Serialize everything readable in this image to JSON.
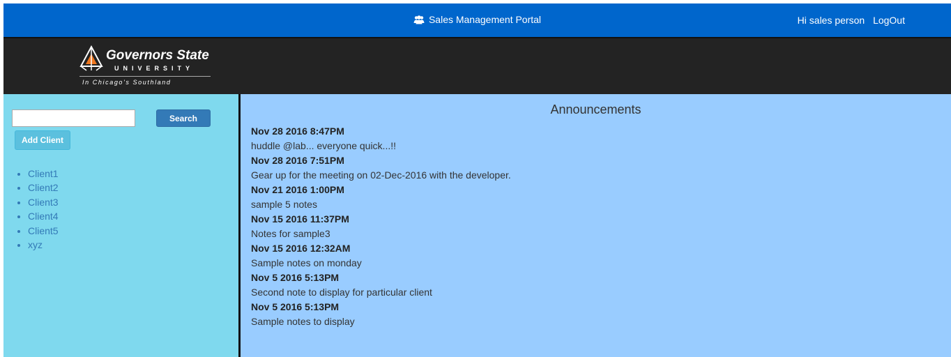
{
  "header": {
    "title": "Sales Management Portal",
    "title_icon": "users-icon",
    "greeting": "Hi sales person",
    "logout_label": "LogOut",
    "bar_color": "#0066cc"
  },
  "logo": {
    "name": "Governors State",
    "university": "UNIVERSITY",
    "tagline": "In Chicago's Southland"
  },
  "sidebar": {
    "search_placeholder": "",
    "search_value": "",
    "search_label": "Search",
    "add_client_label": "Add Client",
    "clients": [
      "Client1",
      "Client2",
      "Client3",
      "Client4",
      "Client5",
      "xyz"
    ],
    "bg_color": "#7fd9ee"
  },
  "main": {
    "title": "Announcements",
    "bg_color": "#99ccff",
    "announcements": [
      {
        "date": "Nov 28 2016 8:47PM",
        "text": "huddle @lab... everyone quick...!!"
      },
      {
        "date": "Nov 28 2016 7:51PM",
        "text": "Gear up for the meeting on 02-Dec-2016 with the developer."
      },
      {
        "date": "Nov 21 2016 1:00PM",
        "text": "sample 5 notes"
      },
      {
        "date": "Nov 15 2016 11:37PM",
        "text": "Notes for sample3"
      },
      {
        "date": "Nov 15 2016 12:32AM",
        "text": "Sample notes on monday"
      },
      {
        "date": "Nov 5 2016 5:13PM",
        "text": "Second note to display for particular client"
      },
      {
        "date": "Nov 5 2016 5:13PM",
        "text": "Sample notes to display"
      }
    ]
  }
}
